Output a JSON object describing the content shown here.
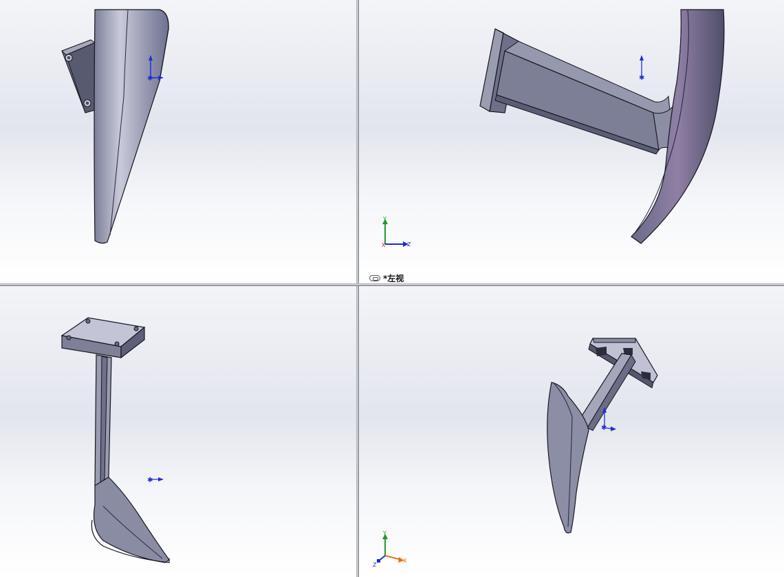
{
  "app": {
    "name": "SolidWorks 3D viewport (four-view)"
  },
  "toolbar": {
    "icons": [
      "zoom-to-fit-icon",
      "zoom-area-icon",
      "previous-view-icon",
      "section-view-icon",
      "view-orientation-icon",
      "display-style-icon",
      "hide-show-icon",
      "edit-appearance-icon",
      "apply-scene-icon",
      "view-settings-icon"
    ]
  },
  "viewports": {
    "top_right": {
      "label": "*左视"
    }
  },
  "triads": {
    "top_right": {
      "y": "Y",
      "x": "X",
      "z": "Z"
    },
    "bottom_right": {
      "y": "Y",
      "x": "X",
      "z": "Z"
    }
  },
  "colors": {
    "background_top": "#e3e5ee",
    "background_bottom": "#ffffff",
    "part_face": "#8a8ca8",
    "part_face_light": "#b3b5c9",
    "part_edge": "#1a1a24",
    "axis_x": "#c81e1e",
    "axis_y": "#1e9a2a",
    "axis_z": "#1e2ad0",
    "origin_blue": "#1f2fd8"
  }
}
